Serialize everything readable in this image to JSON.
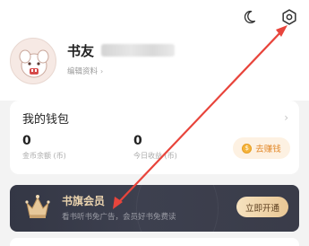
{
  "header": {
    "moon_icon": "moon-icon",
    "settings_icon": "gear-icon"
  },
  "profile": {
    "nickname": "书友",
    "edit_label": "编辑资料",
    "edit_chevron": "›"
  },
  "wallet": {
    "title": "我的钱包",
    "arrow": "›",
    "coins_value": "0",
    "coins_label": "金币余额 (币)",
    "today_value": "0",
    "today_label": "今日收益 (币)",
    "earn_label": "去赚钱",
    "earn_coin_glyph": "$"
  },
  "member": {
    "title": "书旗会员",
    "subtitle": "看书听书免广告，会员好书免费读",
    "button_label": "立即开通"
  },
  "colors": {
    "annotation": "#e8453c",
    "member_bg": "#363946",
    "gold": "#ead3ae",
    "earn_text": "#e38a2c"
  }
}
